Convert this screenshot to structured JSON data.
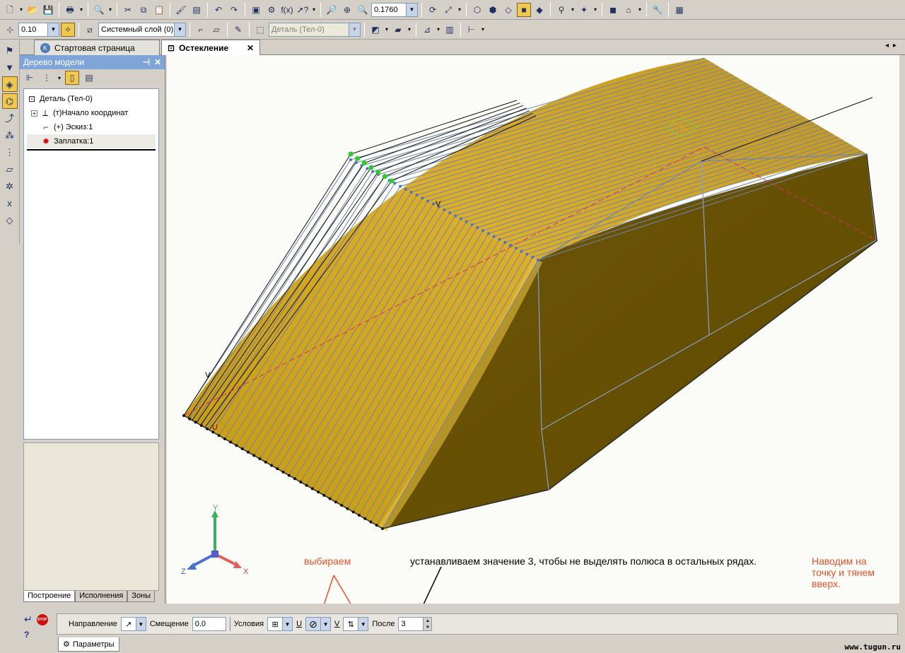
{
  "toolbar": {
    "scale_value": "0.10",
    "layer_value": "Системный слой (0)",
    "part_value": "Деталь (Тел-0)",
    "formula_label": "f(x)",
    "zoom_value": "0.1760"
  },
  "document_tabs": {
    "start": "Стартовая страница",
    "active": "Остекление"
  },
  "tree": {
    "title": "Дерево модели",
    "nodes": [
      {
        "label": "Деталь (Тел-0)"
      },
      {
        "label": "(т)Начало координат"
      },
      {
        "label": "(+) Эскиз:1"
      },
      {
        "label": "Заплатка:1"
      }
    ],
    "tabs": [
      "Построение",
      "Исполнения",
      "Зоны"
    ]
  },
  "viewport": {
    "label_v": "V",
    "label_u": "U",
    "axis_x": "X",
    "axis_y": "Y",
    "axis_z": "Z"
  },
  "annotations": {
    "select": "выбираем",
    "set_value": "устанавливаем значение 3, чтобы не выделять полюса в остальных рядах.",
    "hover": "Наводим на\nточку и тянем\nвверх."
  },
  "properties": {
    "direction_label": "Направление",
    "offset_label": "Смещение",
    "offset_value": "0.0",
    "conditions_label": "Условия",
    "u_label": "U",
    "v_label": "V",
    "after_label": "После",
    "after_value": "3",
    "tab_label": "Параметры"
  },
  "watermark": "www.tugun.ru"
}
